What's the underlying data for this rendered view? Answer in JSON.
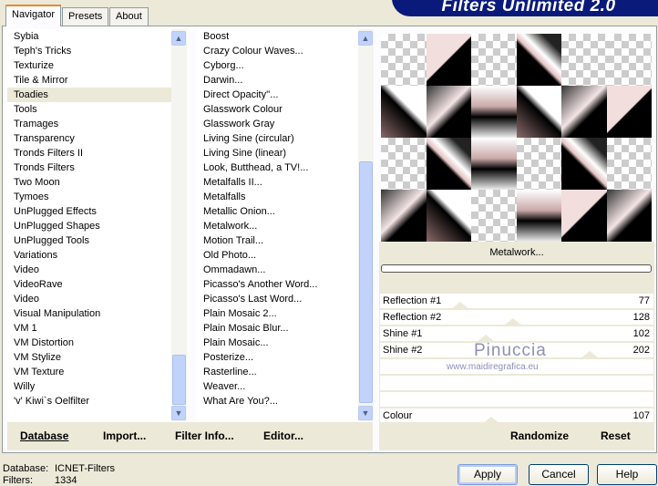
{
  "tabs": [
    {
      "label": "Navigator",
      "active": true
    },
    {
      "label": "Presets"
    },
    {
      "label": "About"
    }
  ],
  "brand": "Filters Unlimited 2.0",
  "categories": [
    "Sybia",
    "Teph's Tricks",
    "Texturize",
    "Tile & Mirror",
    "Toadies",
    "Tools",
    "Tramages",
    "Transparency",
    "Tronds Filters II",
    "Tronds Filters",
    "Two Moon",
    "Tymoes",
    "UnPlugged Effects",
    "UnPlugged Shapes",
    "UnPlugged Tools",
    "Variations",
    "Video",
    "VideoRave",
    "Video",
    "Visual Manipulation",
    "VM 1",
    "VM Distortion",
    "VM Stylize",
    "VM Texture",
    "Willy",
    "'v' Kiwi`s Oelfilter"
  ],
  "selected_category": "Toadies",
  "filters": [
    "Boost",
    "Crazy Colour Waves...",
    "Cyborg...",
    "Darwin...",
    "Direct Opacity''...",
    "Glasswork Colour",
    "Glasswork Gray",
    "Living Sine (circular)",
    "Living Sine (linear)",
    "Look, Butthead, a TV!...",
    "Metalfalls II...",
    "Metalfalls",
    "Metallic Onion...",
    "Metalwork...",
    "Motion Trail...",
    "Old Photo...",
    "Ommadawn...",
    "Picasso's Another Word...",
    "Picasso's Last Word...",
    "Plain Mosaic 2...",
    "Plain Mosaic Blur...",
    "Plain Mosaic...",
    "Posterize...",
    "Rasterline...",
    "Weaver...",
    "What Are You?..."
  ],
  "selected_filter": "Metalwork...",
  "filter_title": "Metalwork...",
  "sliders": [
    {
      "label": "Reflection #1",
      "value": 77
    },
    {
      "label": "Reflection #2",
      "value": 128
    },
    {
      "label": "Shine #1",
      "value": 102
    },
    {
      "label": "Shine #2",
      "value": 202
    },
    {
      "label": "Colour",
      "value": 107
    }
  ],
  "slider_max": 255,
  "buttons": {
    "database": "Database",
    "import": "Import...",
    "filter_info": "Filter Info...",
    "editor": "Editor...",
    "randomize": "Randomize",
    "reset": "Reset",
    "apply": "Apply",
    "cancel": "Cancel",
    "help": "Help"
  },
  "status": {
    "database_label": "Database:",
    "database_value": "ICNET-Filters",
    "filters_label": "Filters:",
    "filters_value": "1334"
  },
  "watermark": {
    "name": "Pinuccia",
    "url": "www.maidiregrafica.eu"
  }
}
